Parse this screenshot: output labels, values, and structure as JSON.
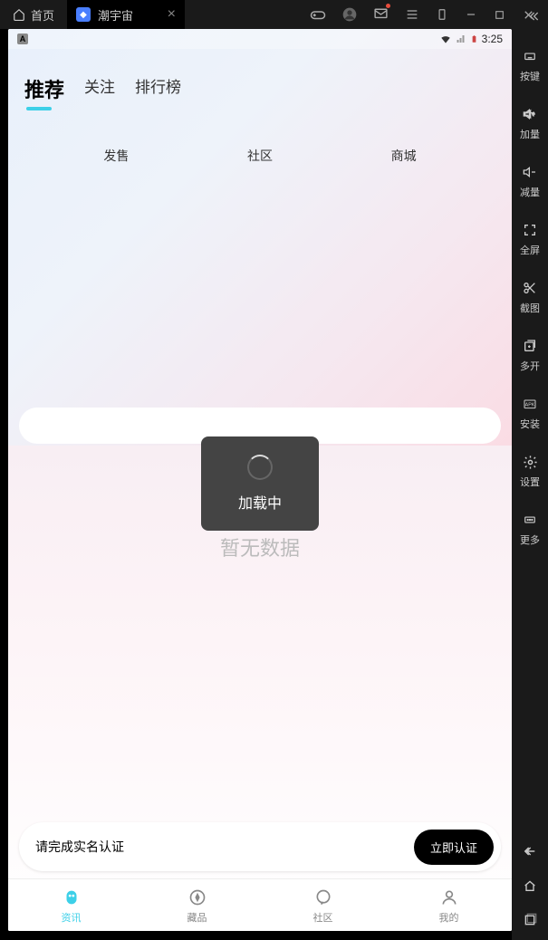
{
  "titlebar": {
    "home": "首页",
    "tab": "潮宇宙"
  },
  "status": {
    "time": "3:25"
  },
  "topTabs": [
    "推荐",
    "关注",
    "排行榜"
  ],
  "subTabs": [
    "发售",
    "社区",
    "商城"
  ],
  "loading": "加载中",
  "empty": "暂无数据",
  "auth": {
    "msg": "请完成实名认证",
    "btn": "立即认证"
  },
  "bottomNav": [
    {
      "label": "资讯"
    },
    {
      "label": "藏品"
    },
    {
      "label": "社区"
    },
    {
      "label": "我的"
    }
  ],
  "sidebar": [
    {
      "label": "按键"
    },
    {
      "label": "加量"
    },
    {
      "label": "减量"
    },
    {
      "label": "全屏"
    },
    {
      "label": "截图"
    },
    {
      "label": "多开"
    },
    {
      "label": "安装"
    },
    {
      "label": "设置"
    },
    {
      "label": "更多"
    }
  ]
}
